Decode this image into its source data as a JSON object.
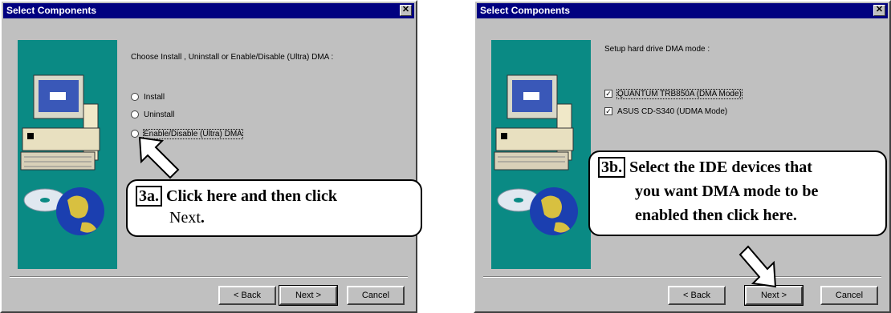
{
  "left_dialog": {
    "title": "Select Components",
    "prompt": "Choose Install , Uninstall or Enable/Disable (Ultra) DMA :",
    "options": [
      "Install",
      "Uninstall",
      "Enable/Disable (Ultra) DMA"
    ],
    "buttons": {
      "back": "< Back",
      "next": "Next >",
      "cancel": "Cancel"
    }
  },
  "right_dialog": {
    "title": "Select Components",
    "prompt": "Setup hard drive DMA mode :",
    "devices": [
      "QUANTUM TRB850A (DMA Mode)",
      "ASUS CD-S340 (UDMA Mode)"
    ],
    "buttons": {
      "back": "< Back",
      "next": "Next >",
      "cancel": "Cancel"
    }
  },
  "callout_3a": {
    "tag": "3a.",
    "line1": "Click here and then click",
    "line2": "Next",
    "line2_end": "."
  },
  "callout_3b": {
    "tag": "3b.",
    "line1": "Select the IDE devices that",
    "line2": "you want DMA mode to be",
    "line3": "enabled then click here."
  }
}
